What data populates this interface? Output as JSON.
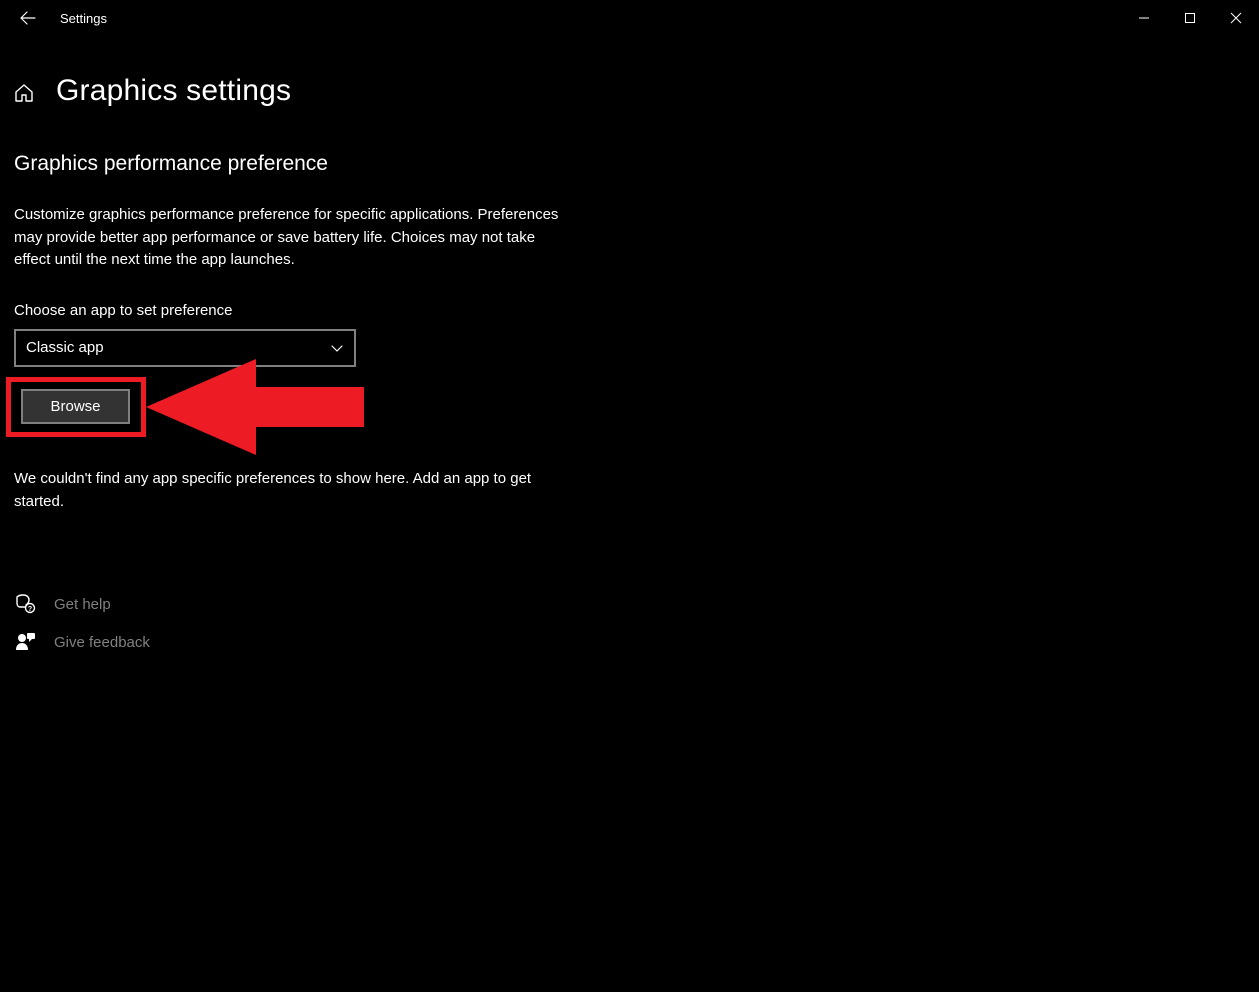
{
  "titlebar": {
    "app_title": "Settings"
  },
  "page": {
    "title": "Graphics settings",
    "section_heading": "Graphics performance preference",
    "description": "Customize graphics performance preference for specific applications. Preferences may provide better app performance or save battery life. Choices may not take effect until the next time the app launches.",
    "choose_label": "Choose an app to set preference",
    "dropdown_value": "Classic app",
    "browse_label": "Browse",
    "no_apps_message": "We couldn't find any app specific preferences to show here. Add an app to get started."
  },
  "links": {
    "get_help": "Get help",
    "give_feedback": "Give feedback"
  }
}
